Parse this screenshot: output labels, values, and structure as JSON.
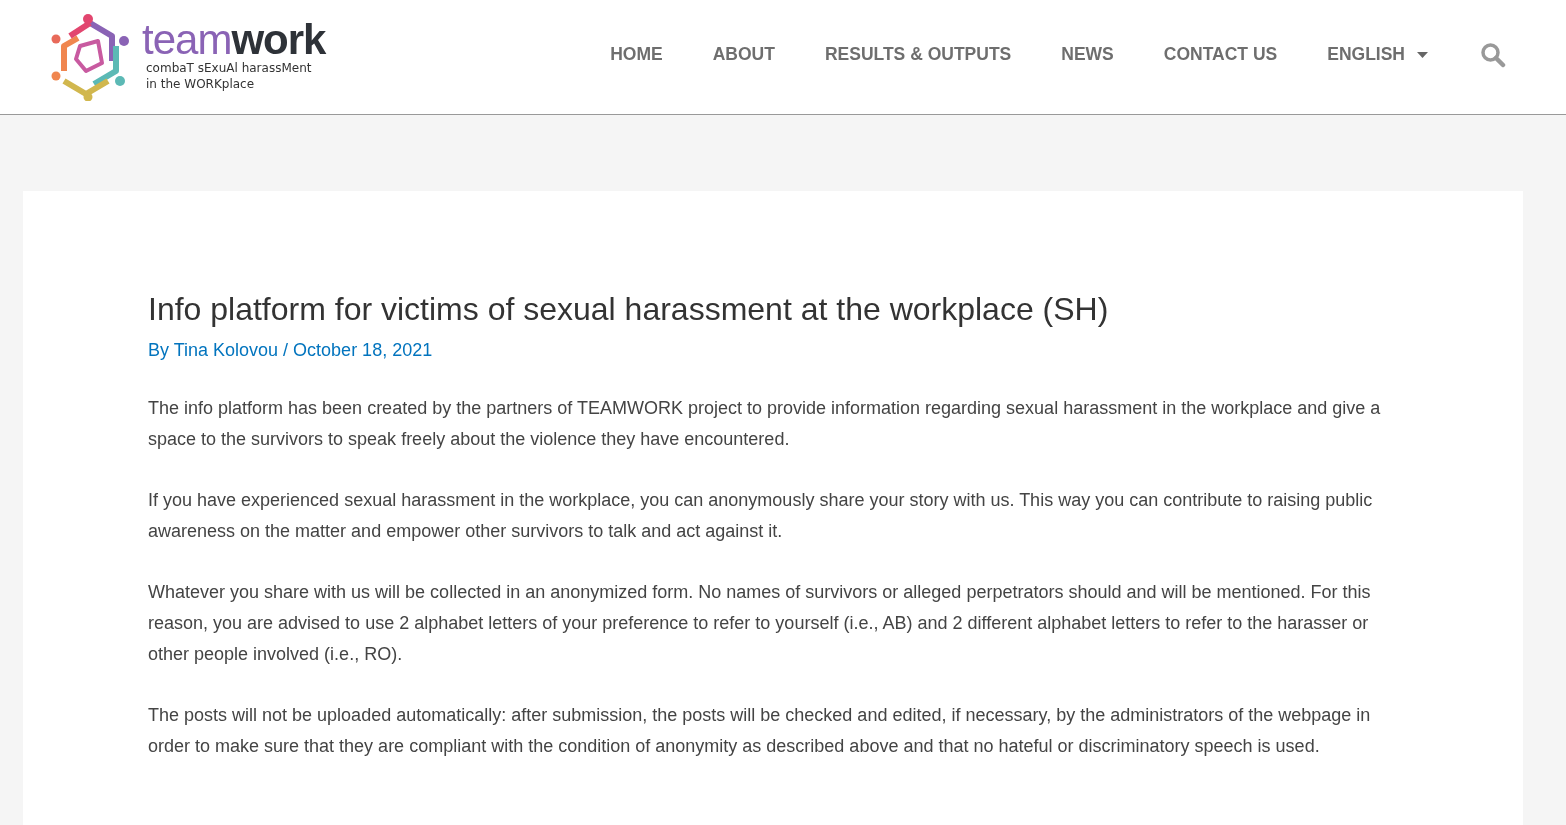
{
  "logo": {
    "word_light": "team",
    "word_bold": "work",
    "tagline": [
      "combaT sExuAl harassMent",
      "in the WORKplace"
    ]
  },
  "nav": [
    {
      "label": "HOME",
      "kind": "link"
    },
    {
      "label": "ABOUT",
      "kind": "link"
    },
    {
      "label": "RESULTS & OUTPUTS",
      "kind": "link"
    },
    {
      "label": "NEWS",
      "kind": "link"
    },
    {
      "label": "CONTACT US",
      "kind": "link"
    },
    {
      "label": "ENGLISH",
      "kind": "dropdown"
    }
  ],
  "article": {
    "title": "Info platform for victims of sexual harassment at the workplace (SH)",
    "author": "By Tina Kolovou",
    "separator": "/",
    "date": "October 18, 2021",
    "paragraphs": [
      "The info platform has been created by the partners of TEAMWORK project to provide information regarding sexual harassment in the workplace and give a space to the survivors to speak freely about the violence they have encountered.",
      "If you have experienced sexual harassment in the workplace, you can anonymously share your story with us. This way you can contribute to raising public awareness on the matter and empower other survivors to talk and act against it.",
      "Whatever you share with us will be collected in an anonymized form. No names of survivors or alleged perpetrators should and will be mentioned. For this reason, you are advised to use 2 alphabet letters of your preference to refer to yourself (i.e., AB) and 2 different alphabet letters to refer to the harasser or other people involved (i.e., RO).",
      "The posts will not be uploaded automatically: after submission, the posts will be checked and edited, if necessary, by the administrators of the webpage in order to make sure that they are compliant with the condition of anonymity as described above and that no hateful or discriminatory speech is used."
    ]
  }
}
